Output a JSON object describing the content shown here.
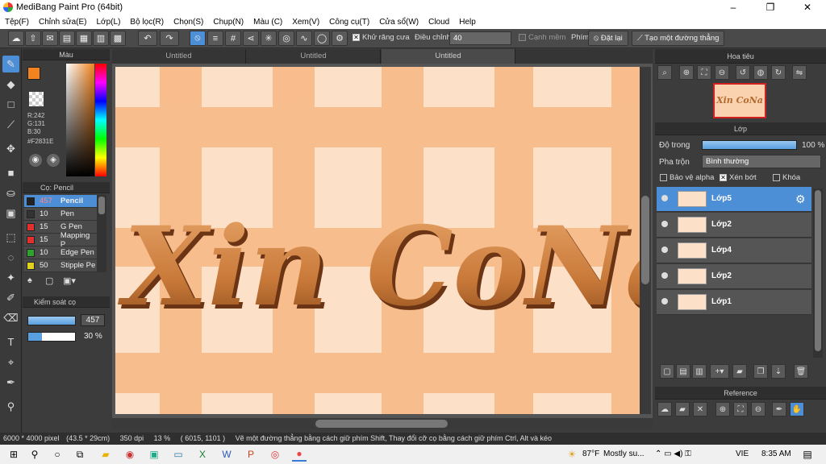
{
  "title": "MediBang Paint Pro (64bit)",
  "window_buttons": [
    "–",
    "❐",
    "✕"
  ],
  "menu": [
    "Tệp(F)",
    "Chỉnh sửa(E)",
    "Lớp(L)",
    "Bộ lọc(R)",
    "Chọn(S)",
    "Chụp(N)",
    "Màu (C)",
    "Xem(V)",
    "Công cụ(T)",
    "Cửa sổ(W)",
    "Cloud",
    "Help"
  ],
  "toolbar": {
    "antialias": "Khử răng cưa",
    "adjust": "Điều chỉnh",
    "adjust_value": "40",
    "smooth_edges": "Cạnh mềm",
    "key_label": "Phím",
    "reset": "Đặt lại",
    "straight_line": "Tạo một đường thẳng"
  },
  "color": {
    "title": "Màu",
    "r": "R:242",
    "g": "G:131",
    "b": "B:30",
    "hex": "#F2831E",
    "fg": "#F2831E",
    "bg": "#5b2ea8"
  },
  "brush": {
    "title": "Cọ: Pencil",
    "items": [
      {
        "size": "457",
        "name": "Pencil",
        "color": "#222222"
      },
      {
        "size": "10",
        "name": "Pen",
        "color": "#333333"
      },
      {
        "size": "15",
        "name": "G Pen",
        "color": "#e03030"
      },
      {
        "size": "15",
        "name": "Mapping P",
        "color": "#e03030"
      },
      {
        "size": "10",
        "name": "Edge Pen",
        "color": "#30a030"
      },
      {
        "size": "50",
        "name": "Stipple Pe",
        "color": "#e0d020"
      }
    ]
  },
  "control": {
    "title": "Kiểm soát cọ",
    "size": "457",
    "opacity": "30 %",
    "opacity_pct": 30
  },
  "tabs": [
    "Untitled",
    "Untitled",
    "Untitled"
  ],
  "canvas_text": "Xin CoNa",
  "navigator": {
    "title": "Hoa tiêu",
    "thumb_text": "Xin CoNa"
  },
  "layers": {
    "title": "Lớp",
    "opacity_label": "Độ trong",
    "opacity_value": "100 %",
    "blend_label": "Pha trộn",
    "blend_value": "Bình thường",
    "protect_alpha": "Bảo vệ alpha",
    "clip": "Xén bớt",
    "lock": "Khóa",
    "items": [
      {
        "name": "Lớp5"
      },
      {
        "name": "Lớp2"
      },
      {
        "name": "Lớp4"
      },
      {
        "name": "Lớp2"
      },
      {
        "name": "Lớp1"
      }
    ]
  },
  "reference": {
    "title": "Reference"
  },
  "status": {
    "size": "6000 * 4000 pixel",
    "cm": "(43.5 * 29cm)",
    "dpi": "350 dpi",
    "zoom": "13 %",
    "coords": "( 6015, 1101 )",
    "hint": "Vẽ một đường thẳng bằng cách giữ phím Shift, Thay đổi cỡ cọ bằng cách giữ phím Ctrl, Alt và kéo"
  },
  "taskbar": {
    "weather": "87°F",
    "weather_text": "Mostly su...",
    "lang": "VIE",
    "time": "8:35 AM"
  }
}
